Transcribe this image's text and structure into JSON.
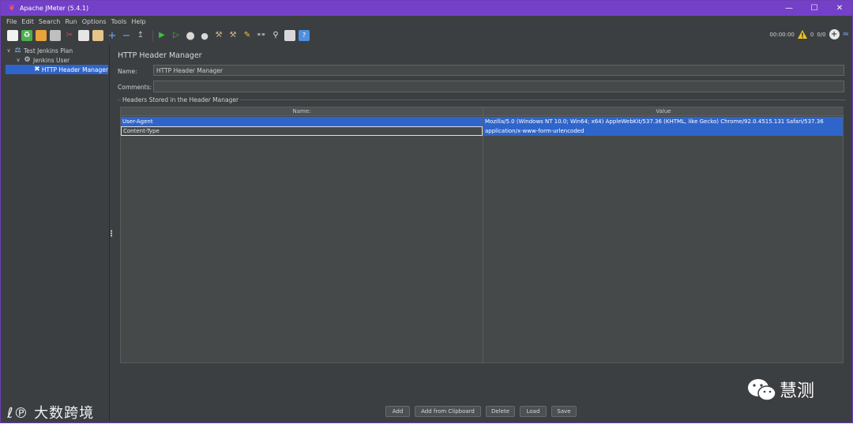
{
  "window": {
    "title": "Apache JMeter (5.4.1)"
  },
  "menu": [
    "File",
    "Edit",
    "Search",
    "Run",
    "Options",
    "Tools",
    "Help"
  ],
  "status": {
    "timer": "00:00:00",
    "warnings": "0",
    "threads": "0/0"
  },
  "tree": {
    "items": [
      {
        "label": "Test Jenkins Plan",
        "icon": "flask-icon"
      },
      {
        "label": "Jenkins User",
        "icon": "gear-icon"
      },
      {
        "label": "HTTP Header Manager",
        "icon": "wrench-icon"
      }
    ]
  },
  "panel": {
    "title": "HTTP Header Manager",
    "name_label": "Name:",
    "name_value": "HTTP Header Manager",
    "comments_label": "Comments:",
    "comments_value": "",
    "group_label": "Headers Stored in the Header Manager"
  },
  "table": {
    "columns": [
      "Name:",
      "Value"
    ],
    "rows": [
      {
        "name": "User-Agent",
        "value": "Mozilla/5.0 (Windows NT 10.0; Win64; x64) AppleWebKit/537.36 (KHTML, like Gecko) Chrome/92.0.4515.131 Safari/537.36"
      },
      {
        "name": "Content-Type",
        "value": "application/x-www-form-urlencoded"
      }
    ]
  },
  "buttons": {
    "add": "Add",
    "add_clipboard": "Add from Clipboard",
    "delete": "Delete",
    "load": "Load",
    "save": "Save"
  },
  "colors": {
    "titlebar": "#7440c8",
    "selection": "#2f65ca",
    "background": "#3c3f41"
  }
}
